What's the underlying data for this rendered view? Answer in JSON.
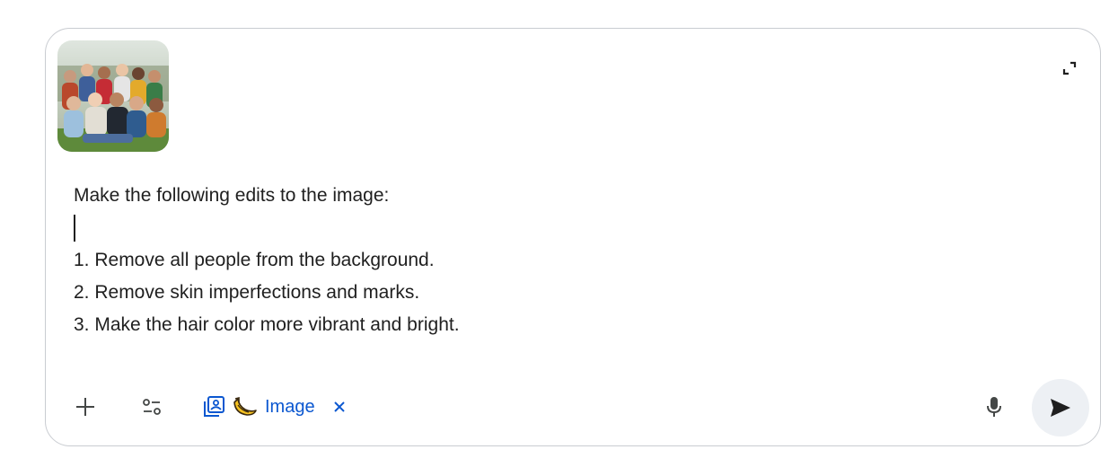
{
  "attachment": {
    "kind": "image",
    "thumbnail_icon": "group-photo-thumbnail"
  },
  "prompt": {
    "lines": [
      "Make the following edits to the image:",
      "",
      "1. Remove all people from the background.",
      "2. Remove skin imperfections and marks.",
      "3. Make the hair color more vibrant and bright."
    ]
  },
  "toolbar": {
    "add_icon": "plus-icon",
    "tools_icon": "tools-toggle-icon",
    "tool_chip": {
      "icons": [
        "image-edit-icon",
        "banana-icon"
      ],
      "label": "Image",
      "close_icon": "close-icon"
    },
    "mic_icon": "mic-icon",
    "send_icon": "send-icon"
  },
  "expand_icon": "expand-icon",
  "colors": {
    "accent": "#0b57d0",
    "text": "#1f1f1f",
    "border": "#c9ccd1",
    "send_bg": "#edf0f4",
    "banana": "#f4c020"
  }
}
